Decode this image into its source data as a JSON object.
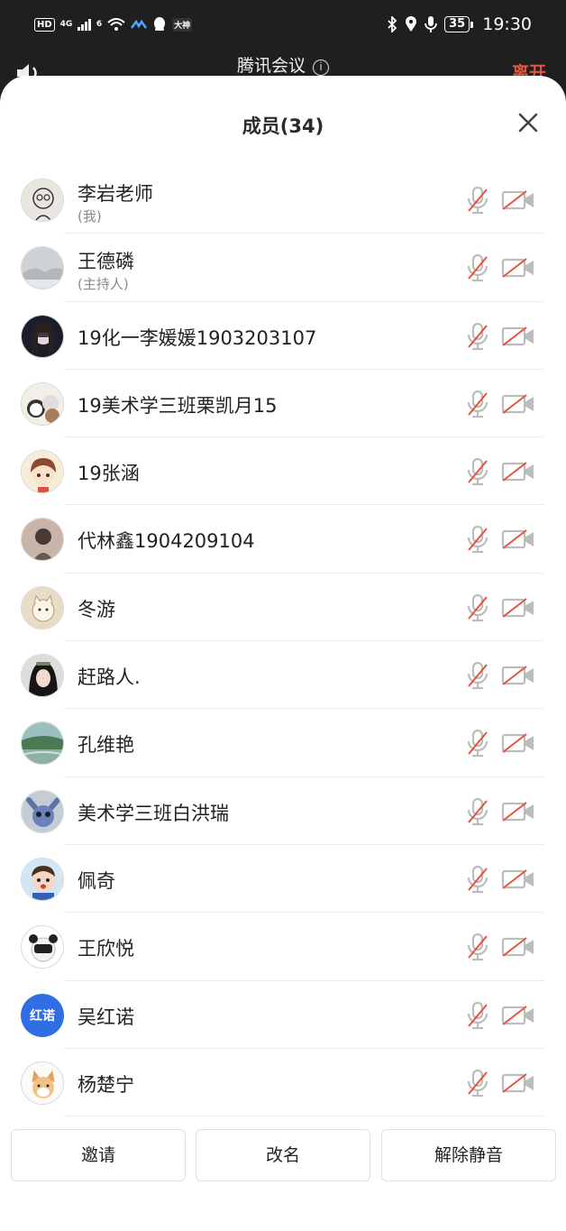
{
  "status_bar": {
    "hd": "HD",
    "network": "4G",
    "wifi_label": "6",
    "icons": [
      "wifi-icon",
      "app-icon",
      "qq-icon",
      "app-badge-icon",
      "bluetooth-icon",
      "location-icon",
      "mic-icon"
    ],
    "badge": "大神",
    "battery": "35",
    "time": "19:30"
  },
  "meeting_header": {
    "title": "腾讯会议",
    "info_icon": "i",
    "leave_label": "离开"
  },
  "panel": {
    "title": "成员(34)",
    "close_icon": "close-icon"
  },
  "members": [
    {
      "name": "李岩老师",
      "role": "(我)",
      "avatar": "sketch",
      "mic": "muted",
      "camera": "off"
    },
    {
      "name": "王德磷",
      "role": "(主持人)",
      "avatar": "landscape-grey",
      "mic": "muted",
      "camera": "off"
    },
    {
      "name": "19化一李媛媛1903203107",
      "role": "",
      "avatar": "girl-dark",
      "mic": "muted",
      "camera": "off"
    },
    {
      "name": "19美术学三班栗凯月15",
      "role": "",
      "avatar": "bears",
      "mic": "muted",
      "camera": "off"
    },
    {
      "name": "19张涵",
      "role": "",
      "avatar": "cartoon-girl",
      "mic": "muted",
      "camera": "off"
    },
    {
      "name": "代林鑫1904209104",
      "role": "",
      "avatar": "girl-back",
      "mic": "muted",
      "camera": "off"
    },
    {
      "name": "冬游",
      "role": "",
      "avatar": "cat-drawing",
      "mic": "muted",
      "camera": "off"
    },
    {
      "name": "赶路人.",
      "role": "",
      "avatar": "girl-portrait",
      "mic": "muted",
      "camera": "off"
    },
    {
      "name": "孔维艳",
      "role": "",
      "avatar": "landscape-green",
      "mic": "muted",
      "camera": "off"
    },
    {
      "name": "美术学三班白洪瑞",
      "role": "",
      "avatar": "stitch",
      "mic": "muted",
      "camera": "off"
    },
    {
      "name": "佩奇",
      "role": "",
      "avatar": "kid",
      "mic": "muted",
      "camera": "off"
    },
    {
      "name": "王欣悦",
      "role": "",
      "avatar": "panda-text",
      "mic": "muted",
      "camera": "off"
    },
    {
      "name": "吴红诺",
      "role": "",
      "avatar": "text",
      "avatar_text": "红诺",
      "mic": "muted",
      "camera": "off"
    },
    {
      "name": "杨楚宁",
      "role": "",
      "avatar": "shiba",
      "mic": "muted",
      "camera": "off"
    }
  ],
  "actions": {
    "invite": "邀请",
    "rename": "改名",
    "unmute_all": "解除静音"
  },
  "colors": {
    "accent_blue": "#2f6fe3",
    "mute_red": "#e5533c",
    "icon_grey": "#b8b8b8",
    "leave_red": "#e5533c"
  }
}
